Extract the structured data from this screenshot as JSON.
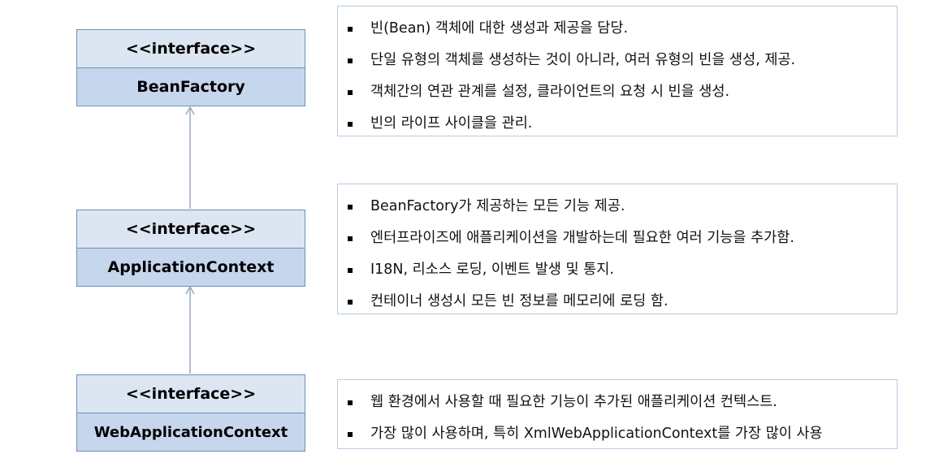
{
  "classes": [
    {
      "stereotype": "<<interface>>",
      "name": "BeanFactory"
    },
    {
      "stereotype": "<<interface>>",
      "name": "ApplicationContext"
    },
    {
      "stereotype": "<<interface>>",
      "name": "WebApplicationContext"
    }
  ],
  "notes": [
    {
      "items": [
        "빈(Bean) 객체에 대한 생성과 제공을 담당.",
        "단일 유형의 객체를 생성하는 것이 아니라, 여러 유형의 빈을 생성, 제공.",
        "객체간의 연관 관계를 설정, 클라이언트의 요청 시 빈을 생성.",
        "빈의 라이프 사이클을 관리."
      ]
    },
    {
      "items": [
        "BeanFactory가 제공하는 모든 기능 제공.",
        "엔터프라이즈에 애플리케이션을 개발하는데 필요한 여러 기능을 추가함.",
        "I18N, 리소스 로딩, 이벤트 발생 및 통지.",
        "컨테이너 생성시 모든 빈 정보를 메모리에 로딩 함."
      ]
    },
    {
      "items": [
        "웹 환경에서 사용할 때 필요한 기능이 추가된 애플리케이션 컨텍스트.",
        "가장 많이 사용하며, 특히 XmlWebApplicationContext를 가장 많이 사용"
      ]
    }
  ],
  "colors": {
    "stereotype_fill": "#dce6f2",
    "name_fill": "#c6d6ec",
    "border": "#6f8fb8",
    "arrow": "#9aa9bd",
    "note_border": "#b8cce4"
  }
}
